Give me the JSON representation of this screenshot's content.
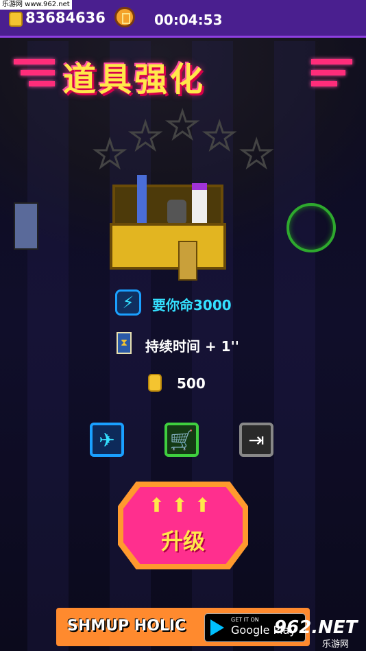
{
  "watermark_top": "乐游网 www.962.net",
  "hud": {
    "coins": "83684636",
    "timer": "00:04:53"
  },
  "title": "道具强化",
  "item": {
    "name": "要你命3000",
    "effect": "持续时间 + 1''",
    "cost": "500"
  },
  "stars": {
    "filled": 0,
    "total": 5
  },
  "buttons": {
    "upgrade_label": "升级"
  },
  "banner": {
    "brand": "SHMUP HOLIC",
    "store_small": "GET IT ON",
    "store_big": "Google Play"
  },
  "watermark_br": {
    "main": "962.NET",
    "sub": "乐游网"
  },
  "colors": {
    "hud_bg": "#4a1f8f",
    "title_fill": "#ffe84a",
    "title_glow": "#ff2d7a",
    "accent_cyan": "#34e0ff",
    "upgrade_fill": "#ff2f8e",
    "upgrade_border": "#ff9a2e"
  },
  "icons": [
    "coin-icon",
    "gold-coin-icon",
    "shield-skull-icon",
    "hourglass-icon",
    "ship-icon",
    "shop-cart-icon",
    "exit-icon",
    "star-empty-icon"
  ]
}
